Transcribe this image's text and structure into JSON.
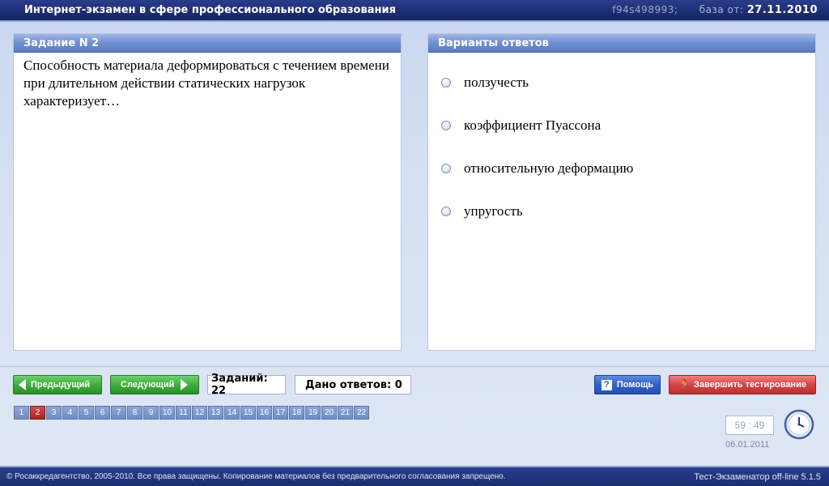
{
  "header": {
    "title": "Интернет-экзамен в сфере профессионального образования",
    "code": "f94s498993;",
    "db_label": "база от:",
    "db_date": "27.11.2010"
  },
  "task": {
    "heading": "Задание N 2",
    "text": "Способность материала деформироваться с течением времени при длительном действии статических нагрузок характеризует…"
  },
  "answers": {
    "heading": "Варианты ответов",
    "options": [
      "ползучесть",
      "коэффициент Пуассона",
      "относительную деформацию",
      "упругость"
    ]
  },
  "nav": {
    "prev_label": "Предыдущий",
    "next_label": "Следующий",
    "tasks_count": "Заданий: 22",
    "answers_given": "Дано ответов: 0",
    "help_label": "Помощь",
    "finish_label": "Завершить тестирование"
  },
  "pager": {
    "pages": [
      "1",
      "2",
      "3",
      "4",
      "5",
      "6",
      "7",
      "8",
      "9",
      "10",
      "11",
      "12",
      "13",
      "14",
      "15",
      "16",
      "17",
      "18",
      "19",
      "20",
      "21",
      "22"
    ],
    "active": "2"
  },
  "timer": {
    "value": "59 : 49",
    "date": "06.01.2011"
  },
  "footer": {
    "copyright": "© Росаккредагентство, 2005-2010. Все права защищены. Копирование материалов без предварительного согласования запрещено.",
    "version": "Тест-Экзаменатор off-line 5.1.5"
  },
  "colors": {
    "header_bg": "#1c2d72",
    "panel_head": "#6f8fd1",
    "green": "#3fae3d",
    "help": "#3162c8",
    "finish": "#d64545",
    "page_active": "#a82626"
  },
  "icons": {
    "help": "question-icon",
    "finish": "running-man-icon",
    "timer": "clock-icon"
  }
}
